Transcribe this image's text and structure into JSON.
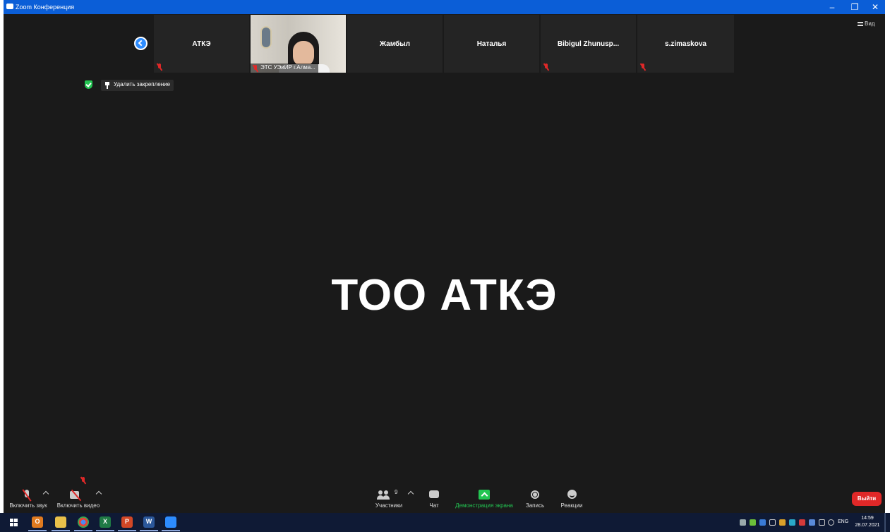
{
  "window": {
    "title": "Zoom Конференция",
    "controls": [
      "minimize",
      "restore",
      "close"
    ]
  },
  "top_right": {
    "view_label": "Вид"
  },
  "participant_strip": {
    "tiles": [
      {
        "name": "АТКЭ",
        "muted": true,
        "video": false
      },
      {
        "name": "ЭТС УЭиИР г.Алма...",
        "muted": true,
        "video": true
      },
      {
        "name": "Жамбыл",
        "muted": false,
        "video": false
      },
      {
        "name": "Наталья",
        "muted": false,
        "video": false
      },
      {
        "name": "Bibigul  Zhunusp...",
        "muted": true,
        "video": false
      },
      {
        "name": "s.zimaskova",
        "muted": true,
        "video": false
      }
    ]
  },
  "pin": {
    "unpin_label": "Удалить закрепление"
  },
  "main_share": {
    "text": "ТОО АТКЭ"
  },
  "toolbar": {
    "audio_label": "Включить звук",
    "video_label": "Включить видео",
    "participants_label": "Участники",
    "participants_count": "9",
    "chat_label": "Чат",
    "share_label": "Демонстрация экрана",
    "record_label": "Запись",
    "reactions_label": "Реакции",
    "leave_label": "Выйти"
  },
  "taskbar": {
    "apps": [
      "outlook",
      "file-explorer",
      "chrome",
      "excel",
      "powerpoint",
      "word",
      "zoom"
    ],
    "language": "ENG",
    "time": "14:59",
    "date": "28.07.2021"
  },
  "colors": {
    "titlebar": "#0b5ed7",
    "background": "#1a1a1a",
    "tile": "#242424",
    "accent_green": "#23c552",
    "leave_red": "#e02828",
    "taskbar": "#0f1a35"
  }
}
